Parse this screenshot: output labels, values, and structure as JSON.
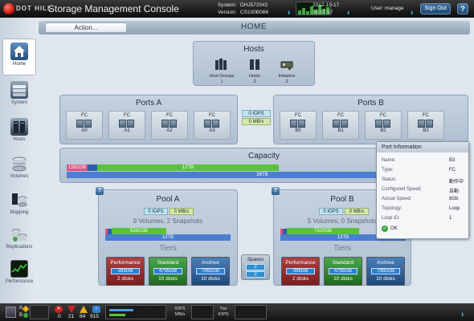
{
  "header": {
    "brand": "DOT HILL",
    "title": "Storage Management Console",
    "system_label": "System:",
    "system_value": "DHJ5720#2",
    "version_label": "Version:",
    "version_value": "CS100B066",
    "date": "2012-10-17",
    "time": "15:57:57",
    "user_label": "User:",
    "user_value": "manage",
    "signout": "Sign Out",
    "help": "?"
  },
  "sidebar": {
    "items": [
      {
        "label": "Home",
        "icon": "house-icon"
      },
      {
        "label": "System",
        "icon": "system-icon"
      },
      {
        "label": "Hosts",
        "icon": "hosts-icon"
      },
      {
        "label": "Volumes",
        "icon": "volumes-icon"
      },
      {
        "label": "Mapping",
        "icon": "mapping-icon"
      },
      {
        "label": "Replications",
        "icon": "replications-icon"
      },
      {
        "label": "Performance",
        "icon": "performance-icon"
      }
    ]
  },
  "toolbar": {
    "action": "Action...",
    "page": "HOME"
  },
  "hosts": {
    "title": "Hosts",
    "groups_label": "Host Groups",
    "groups_value": "1",
    "hosts_label": "Hosts",
    "hosts_value": "2",
    "initiators_label": "Initiators",
    "initiators_value": "2"
  },
  "ports_a": {
    "title": "Ports A",
    "ports": [
      {
        "type": "FC",
        "name": "A0"
      },
      {
        "type": "FC",
        "name": "A1"
      },
      {
        "type": "FC",
        "name": "A2"
      },
      {
        "type": "FC",
        "name": "A3"
      }
    ]
  },
  "ports_b": {
    "title": "Ports B",
    "ports": [
      {
        "type": "FC",
        "name": "B0"
      },
      {
        "type": "FC",
        "name": "B1"
      },
      {
        "type": "FC",
        "name": "B2"
      },
      {
        "type": "FC",
        "name": "B3"
      }
    ]
  },
  "ports_stats": {
    "iops": "0 IOPS",
    "mbs": "0 MB/s"
  },
  "capacity": {
    "title": "Capacity",
    "reserved": "1582GB",
    "used": "12TB",
    "total": "26TB"
  },
  "pool_a": {
    "title": "Pool A",
    "iops": "0 IOPS",
    "mbs": "0 MB/s",
    "summary": "9 Volumes, 2 Snapshots",
    "used": "5281GB",
    "total": "13TB",
    "tiers_title": "Tiers",
    "tiers": [
      {
        "name": "Performance",
        "capacity": "399GB",
        "disks": "2 disks"
      },
      {
        "name": "Standard",
        "capacity": "4795GB",
        "disks": "10 disks"
      },
      {
        "name": "Archive",
        "capacity": "7992GB",
        "disks": "10 disks"
      }
    ]
  },
  "pool_b": {
    "title": "Pool B",
    "iops": "0 IOPS",
    "mbs": "0 MB/s",
    "summary": "5 Volumes, 0 Snapshots",
    "used": "7320GB",
    "total": "13TB",
    "tiers_title": "Tiers",
    "tiers": [
      {
        "name": "Performance",
        "capacity": "399GB",
        "disks": "2 disks"
      },
      {
        "name": "Standard",
        "capacity": "4795GB",
        "disks": "10 disks"
      },
      {
        "name": "Archive",
        "capacity": "7992GB",
        "disks": "10 disks"
      }
    ]
  },
  "spares": {
    "title": "Spares",
    "value_a": "2",
    "value_b": "2"
  },
  "port_info": {
    "title": "Port Information",
    "rows": [
      {
        "label": "Name:",
        "value": "B3"
      },
      {
        "label": "Type:",
        "value": "FC"
      },
      {
        "label": "Status:",
        "value": "動作中"
      },
      {
        "label": "Configured Speed:",
        "value": "自動"
      },
      {
        "label": "Actual Speed:",
        "value": "8Gb"
      },
      {
        "label": "Topology:",
        "value": "Loop"
      },
      {
        "label": "Loop ID:",
        "value": "1"
      }
    ],
    "ok": "OK"
  },
  "statusbar": {
    "ctrl_a": "A",
    "ctrl_b": "B",
    "critical": "0",
    "error": "21",
    "warning": "64",
    "info": "915",
    "iops_label": "IOPS",
    "mbs_label": "MB/s",
    "tier_label": "Tier",
    "tier_iops_label": "IOPS"
  },
  "colors": {
    "accent": "#2f5e8e",
    "green": "#5cc23a",
    "blue": "#4a7fd0",
    "reserved": "#e0507f"
  }
}
